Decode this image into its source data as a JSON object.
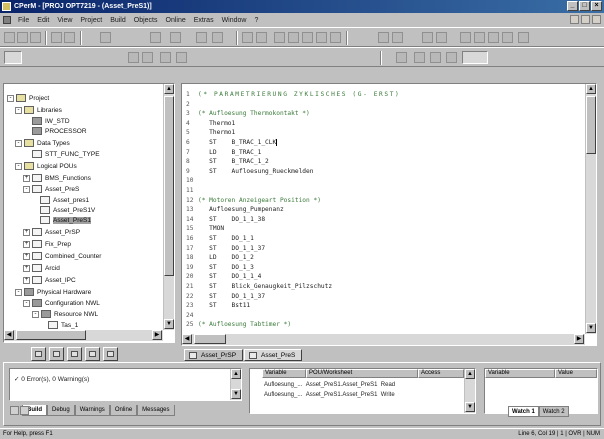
{
  "window": {
    "title": "CPerM - [PROJ OPT7219 - (Asset_PreS1)]"
  },
  "menu": {
    "items": [
      "File",
      "Edit",
      "View",
      "Project",
      "Build",
      "Objects",
      "Online",
      "Extras",
      "Window",
      "?"
    ]
  },
  "tree": {
    "nodes": [
      {
        "label": "Project",
        "depth": 0,
        "expander": "-",
        "icon": "folder"
      },
      {
        "label": "Libraries",
        "depth": 1,
        "expander": "-",
        "icon": "folder"
      },
      {
        "label": "IW_STD",
        "depth": 2,
        "expander": "",
        "icon": "grey"
      },
      {
        "label": "PROCESSOR",
        "depth": 2,
        "expander": "",
        "icon": "grey"
      },
      {
        "label": "Data Types",
        "depth": 1,
        "expander": "-",
        "icon": "folder"
      },
      {
        "label": "STT_FUNC_TYPE",
        "depth": 2,
        "expander": "",
        "icon": "file"
      },
      {
        "label": "Logical POUs",
        "depth": 1,
        "expander": "-",
        "icon": "folder"
      },
      {
        "label": "BMS_Functions",
        "depth": 2,
        "expander": "+",
        "icon": "file"
      },
      {
        "label": "Asset_PreS",
        "depth": 2,
        "expander": "-",
        "icon": "file"
      },
      {
        "label": "Asset_pres1",
        "depth": 3,
        "expander": "",
        "icon": "file"
      },
      {
        "label": "Asset_PreS1V",
        "depth": 3,
        "expander": "",
        "icon": "file"
      },
      {
        "label": "Asset_PreS1",
        "depth": 3,
        "expander": "",
        "icon": "file",
        "selected": true
      },
      {
        "label": "Asset_PrSP",
        "depth": 2,
        "expander": "+",
        "icon": "file"
      },
      {
        "label": "Fix_Prep",
        "depth": 2,
        "expander": "+",
        "icon": "file"
      },
      {
        "label": "Combined_Counter",
        "depth": 2,
        "expander": "+",
        "icon": "file"
      },
      {
        "label": "Arcid",
        "depth": 2,
        "expander": "+",
        "icon": "file"
      },
      {
        "label": "Asset_IPC",
        "depth": 2,
        "expander": "+",
        "icon": "file"
      },
      {
        "label": "Physical Hardware",
        "depth": 1,
        "expander": "-",
        "icon": "grey"
      },
      {
        "label": "Configuration NWL",
        "depth": 2,
        "expander": "-",
        "icon": "grey"
      },
      {
        "label": "Resource NWL",
        "depth": 3,
        "expander": "-",
        "icon": "grey"
      },
      {
        "label": "Tas_1",
        "depth": 4,
        "expander": "",
        "icon": "file"
      }
    ]
  },
  "editor": {
    "lines": [
      {
        "n": "1",
        "text": "(* PARAMETRIERUNG ZYKLISCHES (G- ERST)",
        "kind": "header"
      },
      {
        "n": "2",
        "text": "",
        "kind": "code"
      },
      {
        "n": "3",
        "text": "(* Aufloesung Thermokontakt *)",
        "kind": "comment"
      },
      {
        "n": "4",
        "text": "   Thermo1",
        "kind": "code"
      },
      {
        "n": "5",
        "text": "   Thermo1",
        "kind": "code"
      },
      {
        "n": "6",
        "text": "   ST    B_TRAC_1_CLK",
        "kind": "code",
        "caret": true
      },
      {
        "n": "7",
        "text": "   LD    B_TRAC_1",
        "kind": "code"
      },
      {
        "n": "8",
        "text": "   ST    B_TRAC_1_2",
        "kind": "code"
      },
      {
        "n": "9",
        "text": "   ST    Aufloesung_Rueckmelden",
        "kind": "code"
      },
      {
        "n": "10",
        "text": "",
        "kind": "code"
      },
      {
        "n": "11",
        "text": "",
        "kind": "code"
      },
      {
        "n": "12",
        "text": "(* Motoren Anzeigeart Position *)",
        "kind": "comment"
      },
      {
        "n": "13",
        "text": "   Aufloesung_Pumpenanz",
        "kind": "code"
      },
      {
        "n": "14",
        "text": "   ST    DO_1_1_38",
        "kind": "code"
      },
      {
        "n": "15",
        "text": "   TMON",
        "kind": "code"
      },
      {
        "n": "16",
        "text": "   ST    DO_1_1",
        "kind": "code"
      },
      {
        "n": "17",
        "text": "   ST    DO_1_1_37",
        "kind": "code"
      },
      {
        "n": "18",
        "text": "   LD    DO_1_2",
        "kind": "code"
      },
      {
        "n": "19",
        "text": "   ST    DO_1_3",
        "kind": "code"
      },
      {
        "n": "20",
        "text": "   ST    DO_1_1_4",
        "kind": "code"
      },
      {
        "n": "21",
        "text": "   ST    Blick_Genaugkeit_Pilzschutz",
        "kind": "code"
      },
      {
        "n": "22",
        "text": "   ST    DO_1_1_37",
        "kind": "code"
      },
      {
        "n": "23",
        "text": "   ST    Bst11",
        "kind": "code"
      },
      {
        "n": "24",
        "text": "",
        "kind": "code"
      },
      {
        "n": "25",
        "text": "(* Aufloesung Tabtimer *)",
        "kind": "comment"
      }
    ]
  },
  "editor_tabs": [
    "Asset_PrSP",
    "Asset_PreS"
  ],
  "output": {
    "text": "✓ 0 Error(s), 0 Warning(s)",
    "tabs": [
      "Build",
      "Debug",
      "Warnings",
      "Online",
      "Messages"
    ]
  },
  "xref": {
    "columns": [
      "Variable",
      "POU/Worksheet",
      "Access"
    ],
    "rows": [
      {
        "name": "Aufloesung_...",
        "pou": "Asset_PreS1.Asset_PreS1",
        "access": "Read"
      },
      {
        "name": "Aufloesung_...",
        "pou": "Asset_PreS1.Asset_PreS1",
        "access": "Write"
      }
    ]
  },
  "watch": {
    "columns": [
      "Variable",
      "Value"
    ],
    "tabs": [
      "Watch 1",
      "Watch 2"
    ]
  },
  "status": {
    "left": "For Help, press F1",
    "right": "Line 6, Col 19  |  1 | OVR | NUM"
  }
}
